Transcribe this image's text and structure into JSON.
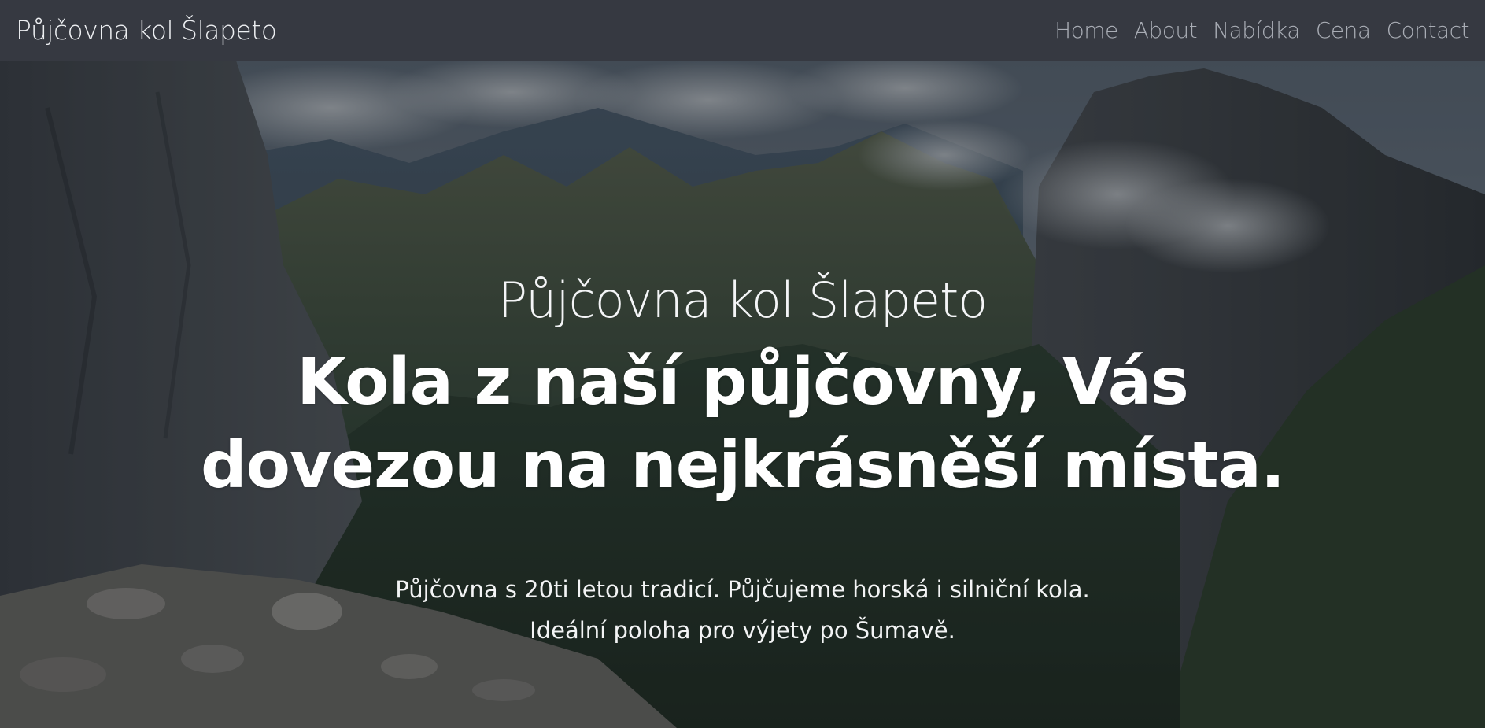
{
  "header": {
    "brand": "Půjčovna kol Šlapeto",
    "nav": [
      {
        "label": "Home"
      },
      {
        "label": "About"
      },
      {
        "label": "Nabídka"
      },
      {
        "label": "Cena"
      },
      {
        "label": "Contact"
      }
    ]
  },
  "hero": {
    "brand": "Půjčovna kol Šlapeto",
    "headline": "Kola z naší půjčovny, Vás dovezou na nejkrásněší místa.",
    "subtitle_line1": "Půjčovna s 20ti letou tradicí. Půjčujeme horská i silniční kola.",
    "subtitle_line2": "Ideální poloha pro výjety po Šumavě."
  },
  "colors": {
    "navbar_bg": "#363941",
    "nav_link": "#a9adb5",
    "brand_text": "#eceef1",
    "hero_text": "#ffffff"
  }
}
